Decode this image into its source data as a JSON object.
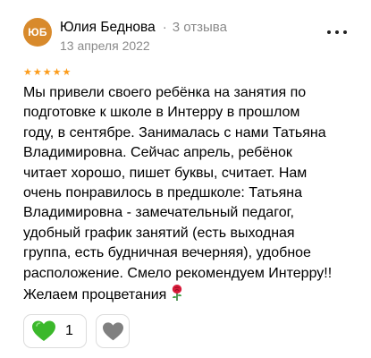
{
  "review": {
    "author": {
      "initials": "ЮБ",
      "name": "Юлия Беднова",
      "reviews_count": "3 отзыва",
      "avatar_color": "#d88a2c"
    },
    "separator": "·",
    "date": "13 апреля 2022",
    "rating": 5,
    "star_color": "#fc9c1b",
    "text_lines": [
      "Мы привели своего ребёнка на занятия по",
      "подготовке к школе в Интерру в прошлом",
      "году, в сентябре. Занималась с нами Татьяна",
      "Владимировна. Сейчас апрель, ребёнок",
      "читает хорошо, пишет буквы, считает. Нам",
      "очень понравилось в предшколе: Татьяна",
      "Владимировна - замечательный педагог,",
      "удобный график занятий (есть выходная",
      "группа, есть будничная вечерняя), удобное",
      "расположение. Смело рекомендуем Интерру!!",
      "Желаем процветания"
    ],
    "text_emoji": "rose-icon",
    "actions": {
      "like_icon": "green-heart-icon",
      "like_color": "#3bb82b",
      "like_count": "1",
      "dislike_icon": "gray-heart-icon",
      "dislike_color": "#808080"
    }
  }
}
